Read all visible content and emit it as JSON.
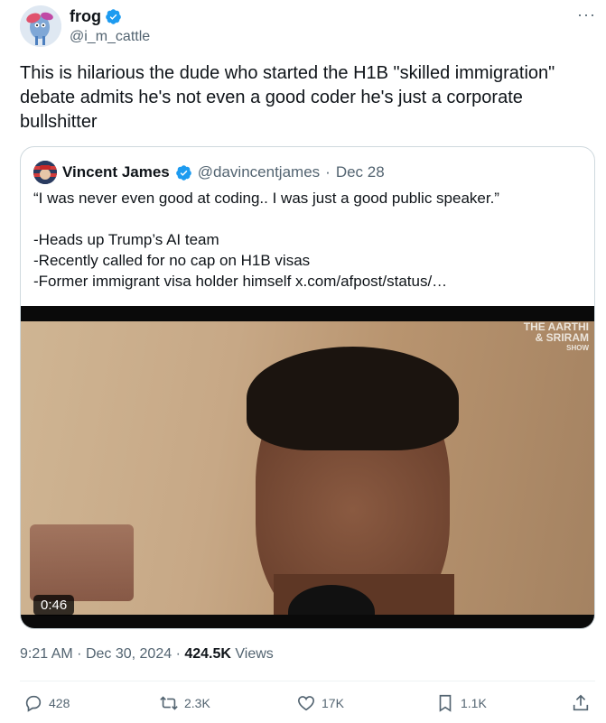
{
  "author": {
    "name": "frog",
    "handle": "@i_m_cattle",
    "verified_color": "#1d9bf0"
  },
  "more_label": "···",
  "tweet_text": "This is hilarious the dude who started the H1B \"skilled immigration\" debate admits he's not even a good coder he's just a corporate bullshitter",
  "quote": {
    "name": "Vincent James",
    "handle": "@davincentjames",
    "separator": "·",
    "date": "Dec 28",
    "lines": [
      "“I was never even good at coding.. I was just a good public speaker.”",
      "-Heads up Trump’s AI team",
      "-Recently called for no cap on H1B visas",
      "-Former immigrant visa holder himself  x.com/afpost/status/…"
    ],
    "video": {
      "duration": "0:46",
      "watermark_line1": "THE AARTHI",
      "watermark_line2": "& SRIRAM",
      "watermark_line3": "SHOW"
    }
  },
  "timestamp": {
    "time": "9:21 AM",
    "sep1": "·",
    "date": "Dec 30, 2024",
    "sep2": "·",
    "views_count": "424.5K",
    "views_label": "Views"
  },
  "actions": {
    "replies": "428",
    "reposts": "2.3K",
    "likes": "17K",
    "bookmarks": "1.1K"
  },
  "icons": [
    "verified-badge-icon",
    "more-icon",
    "reply-icon",
    "repost-icon",
    "like-icon",
    "bookmark-icon",
    "share-icon"
  ]
}
